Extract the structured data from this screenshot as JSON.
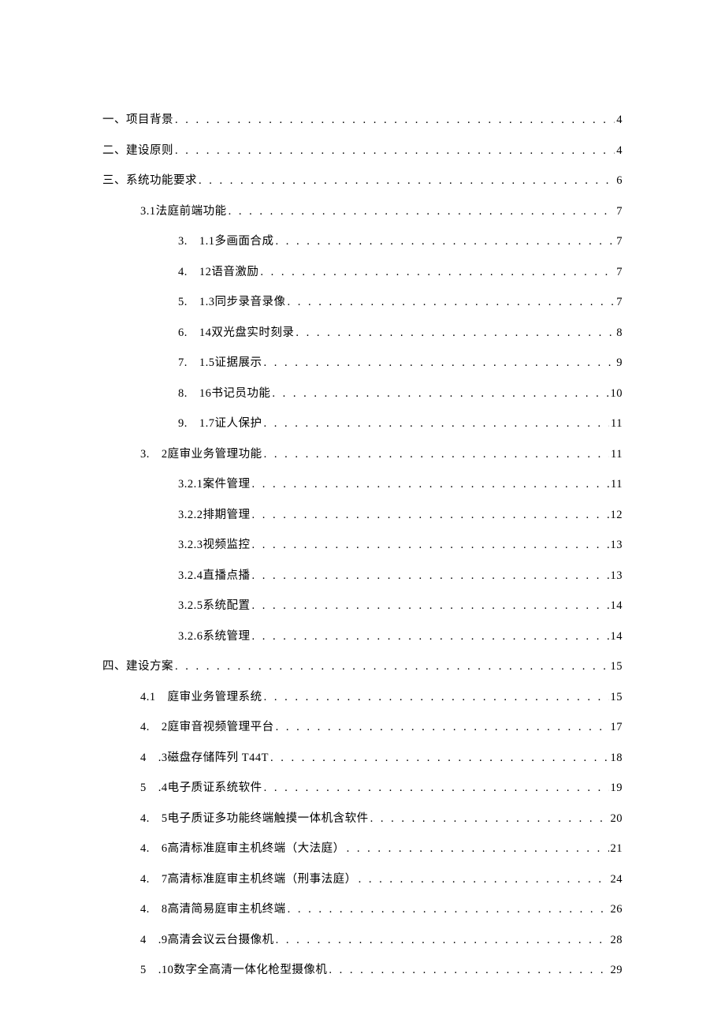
{
  "dots": ". . . . . . . . . . . . . . . . . . . . . . . . . . . . . . . . . . . . . . . . . . . . . . . . . . . . . . . . . . . . . . . . . . . . . . . . . . . . . . . . . . . . . . . . . . . . . . . . . . . .",
  "toc": [
    {
      "level": 0,
      "prefix": "一、",
      "title": "项目背景",
      "page": "4"
    },
    {
      "level": 0,
      "prefix": "二、",
      "title": "建设原则",
      "page": "4"
    },
    {
      "level": 0,
      "prefix": "三、",
      "title": "系统功能要求",
      "page": "6"
    },
    {
      "level": 1,
      "prefix": "3.1 ",
      "title": "法庭前端功能",
      "page": "7"
    },
    {
      "level": 2,
      "prefix": "3.　1.1 ",
      "title": "多画面合成",
      "page": "7"
    },
    {
      "level": 2,
      "prefix": "4.　12 ",
      "title": "语音激励",
      "page": "7"
    },
    {
      "level": 2,
      "prefix": "5.　1.3 ",
      "title": "同步录音录像",
      "page": "7"
    },
    {
      "level": 2,
      "prefix": "6.　14 ",
      "title": "双光盘实时刻录",
      "page": "8"
    },
    {
      "level": 2,
      "prefix": "7.　1.5 ",
      "title": "证据展示",
      "page": "9"
    },
    {
      "level": 2,
      "prefix": "8.　16 ",
      "title": "书记员功能",
      "page": "10"
    },
    {
      "level": 2,
      "prefix": "9.　1.7 ",
      "title": "证人保护",
      "page": "11"
    },
    {
      "level": 1,
      "prefix": "3.　2 ",
      "title": "庭审业务管理功能",
      "page": "11"
    },
    {
      "level": 2,
      "prefix": "3.2.1 ",
      "title": "案件管理",
      "page": "11"
    },
    {
      "level": 2,
      "prefix": "3.2.2 ",
      "title": "排期管理",
      "page": "12"
    },
    {
      "level": 2,
      "prefix": "3.2.3 ",
      "title": "视频监控",
      "page": "13"
    },
    {
      "level": 2,
      "prefix": "3.2.4 ",
      "title": "直播点播",
      "page": "13"
    },
    {
      "level": 2,
      "prefix": "3.2.5 ",
      "title": "系统配置",
      "page": "14"
    },
    {
      "level": 2,
      "prefix": "3.2.6 ",
      "title": "系统管理",
      "page": "14"
    },
    {
      "level": 0,
      "prefix": "四、",
      "title": "建设方案",
      "page": "15"
    },
    {
      "level": 1,
      "prefix": "4.1　",
      "title": "庭审业务管理系统",
      "page": "15"
    },
    {
      "level": 1,
      "prefix": "4.　2 ",
      "title": "庭审音视频管理平台",
      "page": "17"
    },
    {
      "level": 1,
      "prefix": "4　.3 ",
      "title": "磁盘存储阵列 T44T",
      "page": "18"
    },
    {
      "level": 1,
      "prefix": "5　.4 ",
      "title": "电子质证系统软件",
      "page": "19"
    },
    {
      "level": 1,
      "prefix": "4.　5 ",
      "title": "电子质证多功能终端触摸一体机含软件",
      "page": "20"
    },
    {
      "level": 1,
      "prefix": "4.　6 ",
      "title": "高清标准庭审主机终端（大法庭）",
      "page": "21"
    },
    {
      "level": 1,
      "prefix": "4.　7 ",
      "title": "高清标准庭审主机终端（刑事法庭）",
      "page": "24"
    },
    {
      "level": 1,
      "prefix": "4.　8 ",
      "title": "高清简易庭审主机终端",
      "page": "26"
    },
    {
      "level": 1,
      "prefix": "4　.9 ",
      "title": "高清会议云台摄像机",
      "page": "28"
    },
    {
      "level": 1,
      "prefix": "5　.10 ",
      "title": "数字全高清一体化枪型摄像机",
      "page": "29"
    }
  ]
}
